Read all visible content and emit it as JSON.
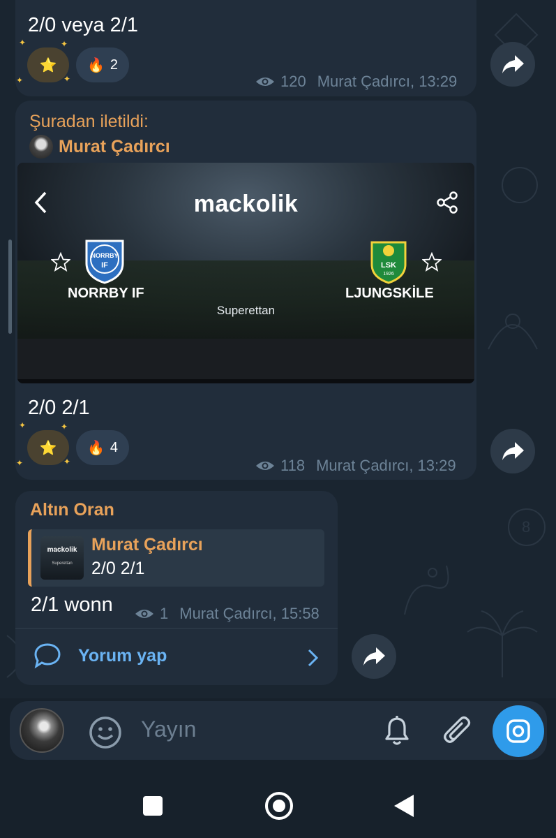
{
  "messages": [
    {
      "text": "2/0 veya 2/1",
      "reactions": [
        {
          "icon": "star-emoji",
          "glyph": "⭐",
          "count": ""
        },
        {
          "icon": "fire-emoji",
          "glyph": "🔥",
          "count": "2"
        }
      ],
      "views": "120",
      "author_time": "Murat Çadırcı, 13:29"
    },
    {
      "forwarded_label": "Şuradan iletildi:",
      "forwarded_from": "Murat Çadırcı",
      "screenshot": {
        "app_logo": "mackolik",
        "home_team": "NORRBY IF",
        "away_team": "LJUNGSKİLE",
        "league": "Superettan",
        "home_crest_text": "NORRBY IF",
        "away_crest_text": "LSK 1926"
      },
      "text": "2/0 2/1",
      "reactions": [
        {
          "icon": "star-emoji",
          "glyph": "⭐",
          "count": ""
        },
        {
          "icon": "fire-emoji",
          "glyph": "🔥",
          "count": "4"
        }
      ],
      "views": "118",
      "author_time": "Murat Çadırcı, 13:29"
    },
    {
      "title": "Altın Oran",
      "reply": {
        "thumb_logo": "mackolik",
        "thumb_league": "Superettan",
        "name": "Murat Çadırcı",
        "text": "2/0 2/1"
      },
      "text": "2/1 wonn",
      "views": "1",
      "author_time": "Murat Çadırcı, 15:58",
      "comment_label": "Yorum yap"
    }
  ],
  "input": {
    "placeholder": "Yayın"
  },
  "colors": {
    "accent_orange": "#e8a25a",
    "link_blue": "#6ab3f3",
    "bubble": "#212d3b",
    "camera_button": "#2f9bea"
  }
}
